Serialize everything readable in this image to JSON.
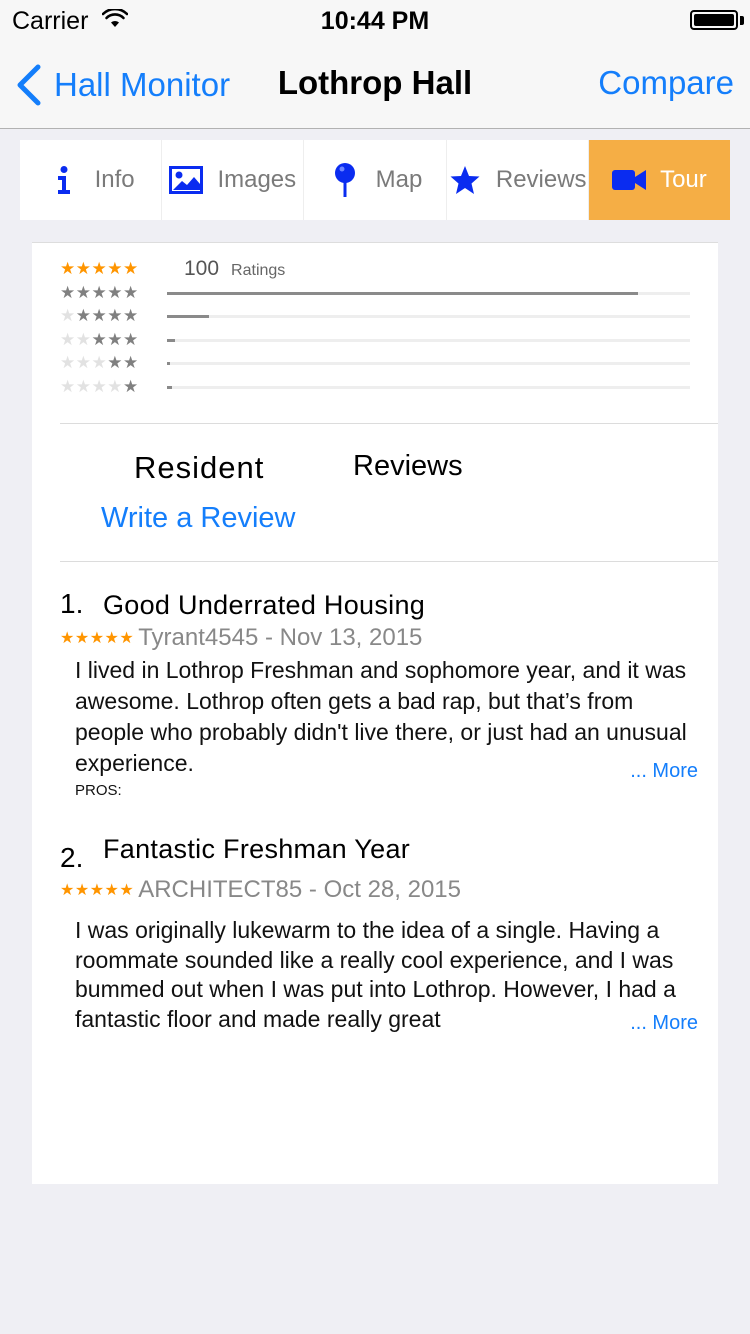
{
  "status_bar": {
    "carrier": "Carrier",
    "time": "10:44 PM"
  },
  "nav": {
    "back_label": "Hall Monitor",
    "title": "Lothrop Hall",
    "compare_label": "Compare"
  },
  "tabs": [
    {
      "label": "Info",
      "icon": "info-icon",
      "active": false
    },
    {
      "label": "Images",
      "icon": "image-icon",
      "active": false
    },
    {
      "label": "Map",
      "icon": "map-pin-icon",
      "active": false
    },
    {
      "label": "Reviews",
      "icon": "star-icon",
      "active": false
    },
    {
      "label": "Tour",
      "icon": "video-camera-icon",
      "active": true
    }
  ],
  "ratings": {
    "count": "100",
    "count_label": "Ratings",
    "breakdown": [
      {
        "stars": 5,
        "fraction": 0.9
      },
      {
        "stars": 4,
        "fraction": 0.08
      },
      {
        "stars": 3,
        "fraction": 0.015
      },
      {
        "stars": 2,
        "fraction": 0.005
      },
      {
        "stars": 1,
        "fraction": 0.01
      }
    ]
  },
  "section": {
    "resident_label": "Resident",
    "reviews_label": "Reviews",
    "write_review_label": "Write a Review"
  },
  "reviews": [
    {
      "number": "1.",
      "title": "Good Underrated Housing",
      "meta": "Tyrant4545 - Nov 13, 2015",
      "body": "I lived in Lothrop Freshman and sophomore year, and it was awesome. Lothrop often gets a bad rap, but that’s from people who probably didn't live there, or just had an unusual experience.",
      "more_label": "... More",
      "pros_label": "PROS:"
    },
    {
      "number": "2.",
      "title": "Fantastic Freshman Year",
      "meta": "ARCHITECT85 - Oct 28, 2015",
      "body": "I was originally lukewarm to the idea of a single. Having a roommate sounded like a really cool experience, and I was bummed out when I was put into Lothrop. However, I had a fantastic floor and made really great",
      "more_label": "... More"
    }
  ],
  "colors": {
    "accent": "#147efb",
    "tab_active": "#f5ae45",
    "star": "#ff9500",
    "icon_blue": "#0a2cf0"
  }
}
